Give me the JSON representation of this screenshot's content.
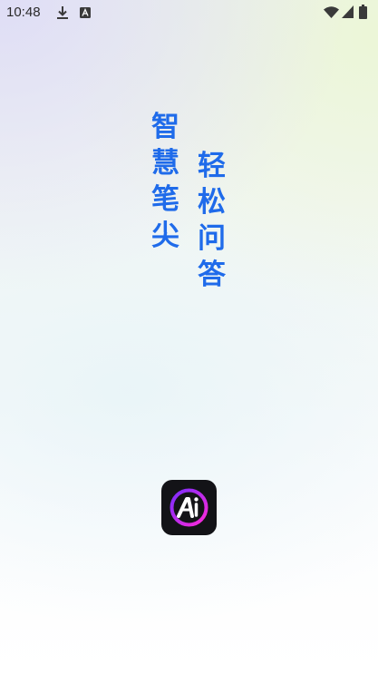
{
  "status_bar": {
    "time": "10:48",
    "icons": [
      "download-icon",
      "notification-icon",
      "wifi-icon",
      "signal-icon",
      "battery-icon"
    ]
  },
  "slogan": {
    "left_column": [
      "智",
      "慧",
      "笔",
      "尖"
    ],
    "right_column": [
      "轻",
      "松",
      "问",
      "答"
    ],
    "color": "#1f6bea"
  },
  "app_logo": {
    "icon": "ai-logo-icon",
    "background_color": "#131317",
    "ring_colors": [
      "#7a2cff",
      "#ff2ad8"
    ]
  }
}
